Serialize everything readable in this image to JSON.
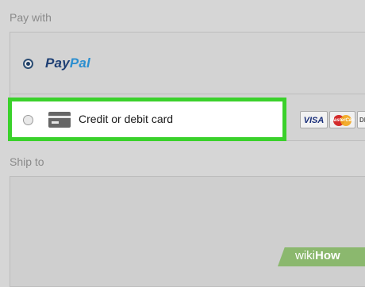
{
  "pay_section": {
    "label": "Pay with",
    "paypal": {
      "logo_part1": "Pay",
      "logo_part2": "Pal",
      "selected": true
    },
    "card": {
      "label": "Credit or debit card",
      "selected": false
    },
    "brands": {
      "visa": "VISA",
      "mastercard": "MasterCard",
      "discover": "DIS"
    }
  },
  "ship_section": {
    "label": "Ship to"
  },
  "watermark": {
    "prefix": "wiki",
    "suffix": "How"
  },
  "colors": {
    "highlight": "#3ad12b",
    "paypal_dark": "#1e3f74",
    "paypal_light": "#2c8fd0",
    "wikihow_green": "#8bb86e"
  }
}
